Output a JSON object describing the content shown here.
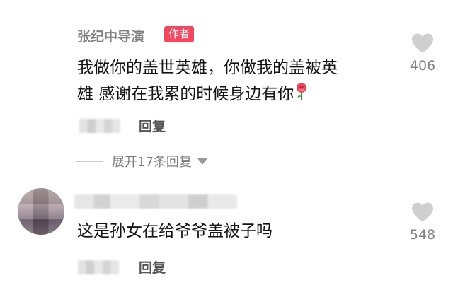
{
  "comments": [
    {
      "username": "张纪中导演",
      "badge": "作者",
      "text_line1": "我做你的盖世英雄，你做我的盖被英",
      "text_line2": "雄 感谢在我累的时候身边有你",
      "emoji": "rose-emoji",
      "reply_label": "回复",
      "likes": "406",
      "expand_label": "展开17条回复"
    },
    {
      "username": "",
      "text_line1": "这是孙女在给爷爷盖被子吗",
      "reply_label": "回复",
      "likes": "548"
    }
  ],
  "icons": {
    "like": "heart-icon",
    "expand": "caret-down-icon"
  },
  "colors": {
    "badge_bg": "#f5465f",
    "text": "#141414",
    "muted": "#808080",
    "heart": "#cfcfcf"
  }
}
